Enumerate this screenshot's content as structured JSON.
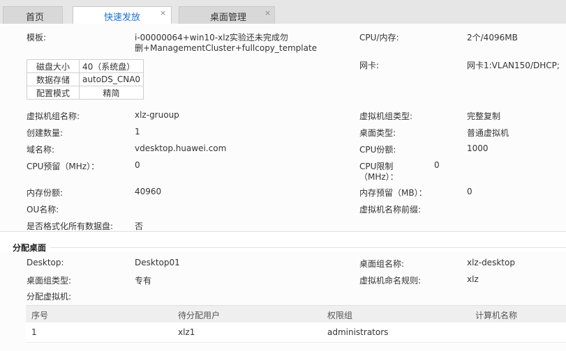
{
  "tabs": [
    {
      "label": "首页"
    },
    {
      "label": "快速发放",
      "close": "×"
    },
    {
      "label": "桌面管理",
      "close": "×"
    }
  ],
  "vm": {
    "template_label": "模板:",
    "template_value_line1": "i-00000064+win10-xlz实验还未完成勿",
    "template_value_line2": "删+ManagementCluster+fullcopy_template",
    "cpu_mem_label": "CPU/内存:",
    "cpu_mem_value": "2个/4096MB",
    "disk_table": [
      {
        "name": "磁盘大小",
        "value": "40（系统盘）"
      },
      {
        "name": "数据存储",
        "value": "autoDS_CNA0"
      },
      {
        "name": "配置模式",
        "value": "精简"
      }
    ],
    "nic_label": "网卡:",
    "nic_value": "网卡1:VLAN150/DHCP;",
    "group_name_label": "虚拟机组名称:",
    "group_name_value": "xlz-gruoup",
    "group_type_label": "虚拟机组类型:",
    "group_type_value": "完整复制",
    "count_label": "创建数量:",
    "count_value": "1",
    "desktop_type_label": "桌面类型:",
    "desktop_type_value": "普通虚拟机",
    "domain_label": "域名称:",
    "domain_value": "vdesktop.huawei.com",
    "cpu_share_label": "CPU份额:",
    "cpu_share_value": "1000",
    "cpu_reserve_label": "CPU预留（MHz）：",
    "cpu_reserve_value": "0",
    "cpu_limit_label_line1": "CPU限制",
    "cpu_limit_label_line2": "（MHz）：",
    "cpu_limit_value": "0",
    "mem_share_label": "内存份额:",
    "mem_share_value": "40960",
    "mem_reserve_label": "内存预留（MB）：",
    "mem_reserve_value": "0",
    "ou_label": "OU名称:",
    "vm_prefix_label": "虚拟机名称前缀:",
    "format_label": "是否格式化所有数据盘:",
    "format_value": "否"
  },
  "assign": {
    "section_title": "分配桌面",
    "desktop_label": "Desktop:",
    "desktop_value": "Desktop01",
    "group_name_label": "桌面组名称:",
    "group_name_value": "xlz-desktop",
    "group_type_label": "桌面组类型:",
    "group_type_value": "专有",
    "naming_rule_label": "虚拟机命名规则:",
    "naming_rule_value": "xlz",
    "assign_vm_label": "分配虚拟机:",
    "table": {
      "headers": [
        "序号",
        "待分配用户",
        "权限组",
        "计算机名称"
      ],
      "rows": [
        [
          "1",
          "xlz1",
          "administrators",
          ""
        ]
      ]
    }
  }
}
